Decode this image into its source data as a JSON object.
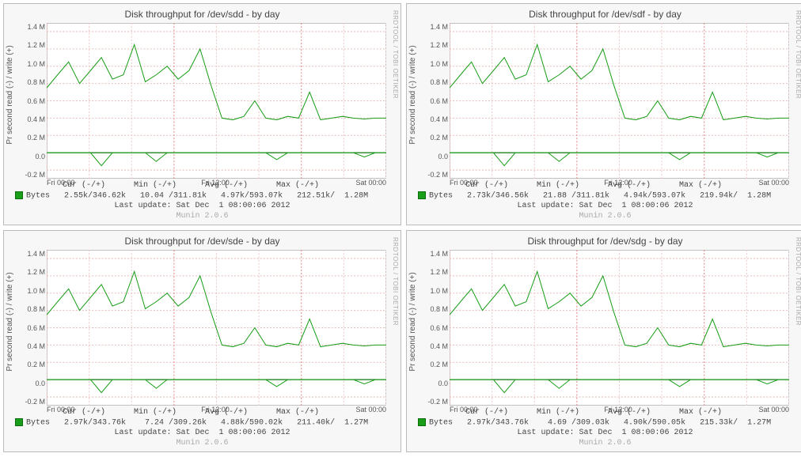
{
  "brand": "RRDTOOL / TOBI OETIKER",
  "munin_version": "Munin 2.0.6",
  "ylabel": "Pr second read (-) / write (+)",
  "yticks": [
    "1.4 M",
    "1.2 M",
    "1.0 M",
    "0.8 M",
    "0.6 M",
    "0.4 M",
    "0.2 M",
    "0.0",
    "-0.2 M"
  ],
  "xticks": [
    "Fri 00:00",
    "Fri 12:00",
    "Sat 00:00"
  ],
  "legend_header": "          Cur (-/+)      Min (-/+)      Avg (-/+)      Max (-/+)",
  "legend_series": "Bytes",
  "last_update": "Last update: Sat Dec  1 08:00:06 2012",
  "panels": [
    {
      "title": "Disk throughput for /dev/sdd - by day",
      "values": "   2.55k/346.62k   10.04 /311.81k   4.97k/593.07k   212.51k/  1.28M"
    },
    {
      "title": "Disk throughput for /dev/sdf - by day",
      "values": "   2.73k/346.56k   21.88 /311.81k   4.94k/593.07k   219.94k/  1.28M"
    },
    {
      "title": "Disk throughput for /dev/sde - by day",
      "values": "   2.97k/343.76k    7.24 /309.26k   4.88k/590.02k   211.40k/  1.27M"
    },
    {
      "title": "Disk throughput for /dev/sdg - by day",
      "values": "   2.97k/343.76k    4.69 /309.03k   4.90k/590.05k   215.33k/  1.27M"
    }
  ],
  "chart_data": [
    {
      "type": "line",
      "title": "Disk throughput for /dev/sdd - by day",
      "xlabel": "",
      "ylabel": "Pr second read (-) / write (+)",
      "ylim": [
        -0.3,
        1.5
      ],
      "x_range": "Fri 00:00 – Sat 08:00",
      "series": [
        {
          "name": "Bytes write (+)",
          "approx_values_M": [
            0.75,
            0.9,
            1.05,
            0.8,
            0.95,
            1.1,
            0.85,
            0.9,
            1.25,
            0.82,
            0.9,
            1.0,
            0.85,
            0.95,
            1.2,
            0.78,
            0.4,
            0.38,
            0.42,
            0.6,
            0.4,
            0.38,
            0.42,
            0.4,
            0.7,
            0.38,
            0.4,
            0.42,
            0.4,
            0.39,
            0.4,
            0.4
          ]
        },
        {
          "name": "Bytes read (-)",
          "approx_values_M": [
            0,
            0,
            0,
            0,
            0,
            -0.15,
            0,
            0,
            0,
            0,
            -0.1,
            0,
            0,
            0,
            0,
            0,
            0,
            0,
            0,
            0,
            0,
            -0.08,
            0,
            0,
            0,
            0,
            0,
            0,
            0,
            -0.05,
            0,
            0
          ]
        }
      ],
      "stats": {
        "cur": "2.55k/346.62k",
        "min": "10.04 /311.81k",
        "avg": "4.97k/593.07k",
        "max": "212.51k/1.28M"
      }
    },
    {
      "type": "line",
      "title": "Disk throughput for /dev/sdf - by day",
      "xlabel": "",
      "ylabel": "Pr second read (-) / write (+)",
      "ylim": [
        -0.3,
        1.5
      ],
      "x_range": "Fri 00:00 – Sat 08:00",
      "series": [
        {
          "name": "Bytes write (+)",
          "approx_values_M": [
            0.75,
            0.9,
            1.05,
            0.8,
            0.95,
            1.1,
            0.85,
            0.9,
            1.25,
            0.82,
            0.9,
            1.0,
            0.85,
            0.95,
            1.2,
            0.78,
            0.4,
            0.38,
            0.42,
            0.6,
            0.4,
            0.38,
            0.42,
            0.4,
            0.7,
            0.38,
            0.4,
            0.42,
            0.4,
            0.39,
            0.4,
            0.4
          ]
        },
        {
          "name": "Bytes read (-)",
          "approx_values_M": [
            0,
            0,
            0,
            0,
            0,
            -0.15,
            0,
            0,
            0,
            0,
            -0.1,
            0,
            0,
            0,
            0,
            0,
            0,
            0,
            0,
            0,
            0,
            -0.08,
            0,
            0,
            0,
            0,
            0,
            0,
            0,
            -0.05,
            0,
            0
          ]
        }
      ],
      "stats": {
        "cur": "2.73k/346.56k",
        "min": "21.88 /311.81k",
        "avg": "4.94k/593.07k",
        "max": "219.94k/1.28M"
      }
    },
    {
      "type": "line",
      "title": "Disk throughput for /dev/sde - by day",
      "xlabel": "",
      "ylabel": "Pr second read (-) / write (+)",
      "ylim": [
        -0.3,
        1.5
      ],
      "x_range": "Fri 00:00 – Sat 08:00",
      "series": [
        {
          "name": "Bytes write (+)",
          "approx_values_M": [
            0.75,
            0.9,
            1.05,
            0.8,
            0.95,
            1.1,
            0.85,
            0.9,
            1.25,
            0.82,
            0.9,
            1.0,
            0.85,
            0.95,
            1.2,
            0.78,
            0.4,
            0.38,
            0.42,
            0.6,
            0.4,
            0.38,
            0.42,
            0.4,
            0.7,
            0.38,
            0.4,
            0.42,
            0.4,
            0.39,
            0.4,
            0.4
          ]
        },
        {
          "name": "Bytes read (-)",
          "approx_values_M": [
            0,
            0,
            0,
            0,
            0,
            -0.15,
            0,
            0,
            0,
            0,
            -0.1,
            0,
            0,
            0,
            0,
            0,
            0,
            0,
            0,
            0,
            0,
            -0.08,
            0,
            0,
            0,
            0,
            0,
            0,
            0,
            -0.05,
            0,
            0
          ]
        }
      ],
      "stats": {
        "cur": "2.97k/343.76k",
        "min": "7.24 /309.26k",
        "avg": "4.88k/590.02k",
        "max": "211.40k/1.27M"
      }
    },
    {
      "type": "line",
      "title": "Disk throughput for /dev/sdg - by day",
      "xlabel": "",
      "ylabel": "Pr second read (-) / write (+)",
      "ylim": [
        -0.3,
        1.5
      ],
      "x_range": "Fri 00:00 – Sat 08:00",
      "series": [
        {
          "name": "Bytes write (+)",
          "approx_values_M": [
            0.75,
            0.9,
            1.05,
            0.8,
            0.95,
            1.1,
            0.85,
            0.9,
            1.25,
            0.82,
            0.9,
            1.0,
            0.85,
            0.95,
            1.2,
            0.78,
            0.4,
            0.38,
            0.42,
            0.6,
            0.4,
            0.38,
            0.42,
            0.4,
            0.7,
            0.38,
            0.4,
            0.42,
            0.4,
            0.39,
            0.4,
            0.4
          ]
        },
        {
          "name": "Bytes read (-)",
          "approx_values_M": [
            0,
            0,
            0,
            0,
            0,
            -0.15,
            0,
            0,
            0,
            0,
            -0.1,
            0,
            0,
            0,
            0,
            0,
            0,
            0,
            0,
            0,
            0,
            -0.08,
            0,
            0,
            0,
            0,
            0,
            0,
            0,
            -0.05,
            0,
            0
          ]
        }
      ],
      "stats": {
        "cur": "2.97k/343.76k",
        "min": "4.69 /309.03k",
        "avg": "4.90k/590.05k",
        "max": "215.33k/1.27M"
      }
    }
  ]
}
